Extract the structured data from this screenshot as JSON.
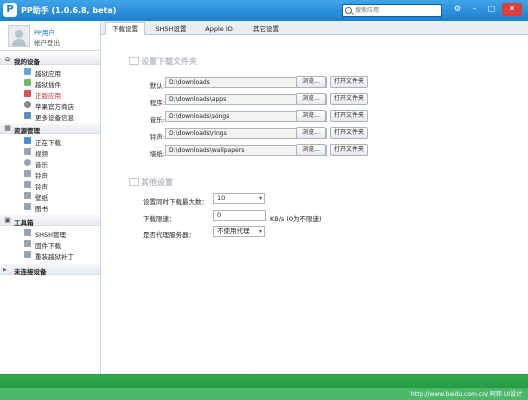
{
  "window": {
    "logo_letter": "P",
    "title": "PP助手 (1.0.6.8, beta)",
    "search_placeholder": "搜索应用"
  },
  "user": {
    "name": "PP用户",
    "subtitle": "帐户登出"
  },
  "sidebar": {
    "sections": [
      {
        "label": "我的设备",
        "items": [
          "越狱应用",
          "越狱插件",
          "正版应用",
          "苹果官方商店",
          "更多设备信息"
        ]
      },
      {
        "label": "资源管理",
        "items": [
          "正在下载",
          "视频",
          "音乐",
          "铃声",
          "铃声",
          "壁纸",
          "图书"
        ]
      },
      {
        "label": "工具箱",
        "items": [
          "SHSH管理",
          "固件下载",
          "重装越狱补丁"
        ]
      },
      {
        "label": "未连接设备",
        "items": []
      }
    ],
    "active_item": "正版应用"
  },
  "tabs": [
    "下载设置",
    "SHSH设置",
    "Apple ID",
    "其它设置"
  ],
  "download_folders": {
    "title": "设置下载文件夹",
    "rows": [
      {
        "label": "默认:",
        "path": "D:\\downloads"
      },
      {
        "label": "程序:",
        "path": "D:\\downloads\\apps"
      },
      {
        "label": "音乐:",
        "path": "D:\\downloads\\songs"
      },
      {
        "label": "铃声:",
        "path": "D:\\downloads\\rings"
      },
      {
        "label": "墙纸:",
        "path": "D:\\downloads\\wallpapers"
      }
    ],
    "browse_label": "浏览...",
    "open_label": "打开文件夹"
  },
  "other_settings": {
    "title": "其他设置",
    "max_downloads_label": "设置同时下载最大数：",
    "max_downloads_value": "10",
    "speed_label": "下载限速：",
    "speed_value": "0",
    "speed_unit": "KB/s (0为不限速)",
    "proxy_label": "是否代理服务器：",
    "proxy_value": "不使用代理"
  },
  "status": {
    "watermark": "http://www.baidu.com.cn/ 阿邦 UI设计"
  },
  "colors": {
    "titlebar": "#1b7fcf",
    "statusbar": "#22913f",
    "active_item": "#d02c2c"
  }
}
